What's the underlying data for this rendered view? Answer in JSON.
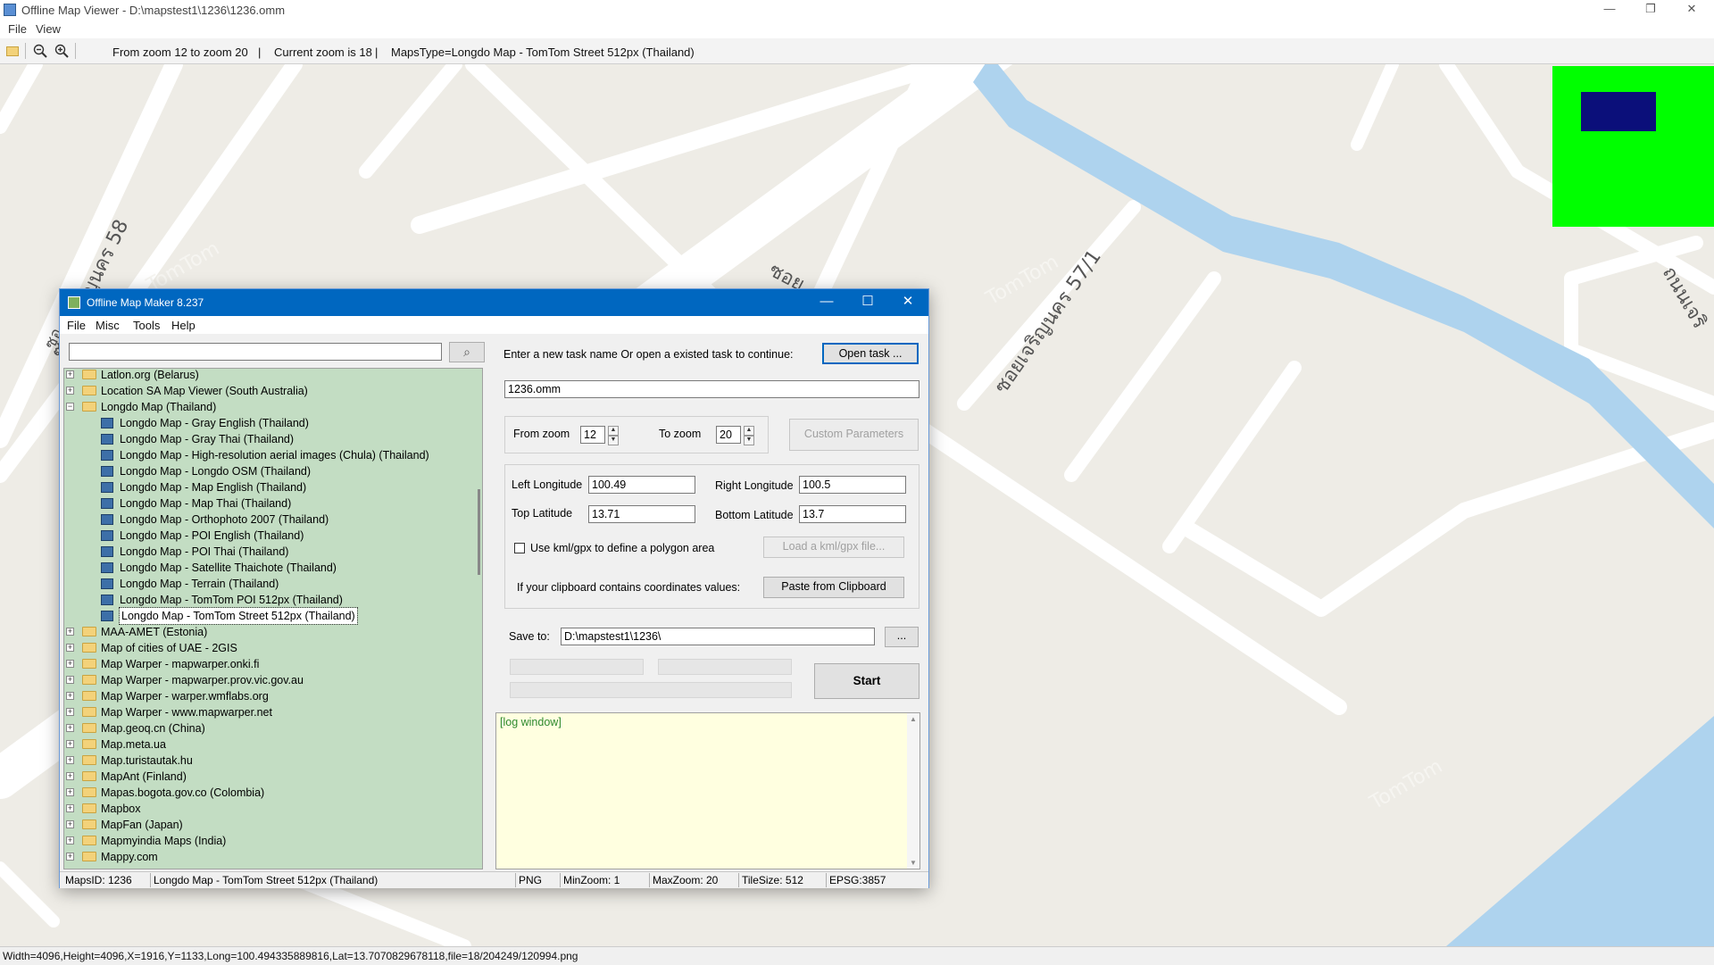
{
  "window": {
    "title": "Offline Map Viewer - D:\\mapstest1\\1236\\1236.omm",
    "controls": {
      "minimize": "—",
      "restore": "❐",
      "close": "✕"
    }
  },
  "menu": {
    "file": "File",
    "view": "View"
  },
  "toolbar": {
    "zoom_range": "From zoom 12 to zoom 20",
    "separator": "|",
    "current_zoom": "Current zoom is 18",
    "separator2": "|",
    "maps_type": "MapsType=Longdo Map - TomTom Street 512px (Thailand)"
  },
  "map": {
    "labels": [
      "ซอยเจริญนคร 58",
      "ซอยเจริญนคร 57/1",
      "ซอย",
      "ถนนเจริ",
      "ซอ",
      "ร"
    ],
    "watermark": "TomTom"
  },
  "statusbar": {
    "text": "Width=4096,Height=4096,X=1916,Y=1133,Long=100.494335889816,Lat=13.7070829678118,file=18/204249/120994.png"
  },
  "dialog": {
    "title": "Offline Map Maker 8.237",
    "controls": {
      "minimize": "—",
      "maximize": "☐",
      "close": "✕"
    },
    "menu": {
      "file": "File",
      "misc": "Misc",
      "tools": "Tools",
      "help": "Help"
    },
    "search": {
      "value": "",
      "button_icon": "⌕"
    },
    "tree": [
      {
        "label": "Latlon.org (Belarus)",
        "level": 0,
        "type": "folder",
        "expander": "+"
      },
      {
        "label": "Location SA Map Viewer (South Australia)",
        "level": 0,
        "type": "folder",
        "expander": "+"
      },
      {
        "label": "Longdo Map (Thailand)",
        "level": 0,
        "type": "folder-open",
        "expander": "−"
      },
      {
        "label": "Longdo Map - Gray English (Thailand)",
        "level": 1,
        "type": "map"
      },
      {
        "label": "Longdo Map - Gray Thai (Thailand)",
        "level": 1,
        "type": "map"
      },
      {
        "label": "Longdo Map - High-resolution aerial images (Chula) (Thailand)",
        "level": 1,
        "type": "map"
      },
      {
        "label": "Longdo Map - Longdo OSM (Thailand)",
        "level": 1,
        "type": "map"
      },
      {
        "label": "Longdo Map - Map English (Thailand)",
        "level": 1,
        "type": "map"
      },
      {
        "label": "Longdo Map - Map Thai (Thailand)",
        "level": 1,
        "type": "map"
      },
      {
        "label": "Longdo Map - Orthophoto 2007 (Thailand)",
        "level": 1,
        "type": "map"
      },
      {
        "label": "Longdo Map - POI English (Thailand)",
        "level": 1,
        "type": "map"
      },
      {
        "label": "Longdo Map - POI Thai (Thailand)",
        "level": 1,
        "type": "map"
      },
      {
        "label": "Longdo Map - Satellite Thaichote (Thailand)",
        "level": 1,
        "type": "map"
      },
      {
        "label": "Longdo Map - Terrain (Thailand)",
        "level": 1,
        "type": "map"
      },
      {
        "label": "Longdo Map - TomTom POI 512px (Thailand)",
        "level": 1,
        "type": "map"
      },
      {
        "label": "Longdo Map - TomTom Street 512px (Thailand)",
        "level": 1,
        "type": "map",
        "selected": true
      },
      {
        "label": "MAA-AMET (Estonia)",
        "level": 0,
        "type": "folder",
        "expander": "+"
      },
      {
        "label": "Map of cities of UAE - 2GIS",
        "level": 0,
        "type": "folder",
        "expander": "+"
      },
      {
        "label": "Map Warper - mapwarper.onki.fi",
        "level": 0,
        "type": "folder",
        "expander": "+"
      },
      {
        "label": "Map Warper - mapwarper.prov.vic.gov.au",
        "level": 0,
        "type": "folder",
        "expander": "+"
      },
      {
        "label": "Map Warper - warper.wmflabs.org",
        "level": 0,
        "type": "folder",
        "expander": "+"
      },
      {
        "label": "Map Warper - www.mapwarper.net",
        "level": 0,
        "type": "folder",
        "expander": "+"
      },
      {
        "label": "Map.geoq.cn (China)",
        "level": 0,
        "type": "folder",
        "expander": "+"
      },
      {
        "label": "Map.meta.ua",
        "level": 0,
        "type": "folder",
        "expander": "+"
      },
      {
        "label": "Map.turistautak.hu",
        "level": 0,
        "type": "folder",
        "expander": "+"
      },
      {
        "label": "MapAnt (Finland)",
        "level": 0,
        "type": "folder",
        "expander": "+"
      },
      {
        "label": "Mapas.bogota.gov.co (Colombia)",
        "level": 0,
        "type": "folder",
        "expander": "+"
      },
      {
        "label": "Mapbox",
        "level": 0,
        "type": "folder",
        "expander": "+"
      },
      {
        "label": "MapFan (Japan)",
        "level": 0,
        "type": "folder",
        "expander": "+"
      },
      {
        "label": "Mapmyindia Maps (India)",
        "level": 0,
        "type": "folder",
        "expander": "+"
      },
      {
        "label": "Mappy.com",
        "level": 0,
        "type": "folder",
        "expander": "+"
      }
    ],
    "task": {
      "prompt": "Enter a new task name Or open a existed task to continue:",
      "open_button": "Open task ...",
      "name_value": "1236.omm"
    },
    "zoom": {
      "from_label": "From zoom",
      "from_value": "12",
      "to_label": "To zoom",
      "to_value": "20",
      "custom_button": "Custom Parameters",
      "spin_up": "▲",
      "spin_down": "▼"
    },
    "bounds": {
      "left_label": "Left Longitude",
      "left_value": "100.49",
      "right_label": "Right Longitude",
      "right_value": "100.5",
      "top_label": "Top Latitude",
      "top_value": "13.71",
      "bottom_label": "Bottom Latitude",
      "bottom_value": "13.7"
    },
    "kml": {
      "checkbox_label": "Use kml/gpx to define a polygon area",
      "checked": false,
      "load_button": "Load a kml/gpx file..."
    },
    "clipboard": {
      "label": "If your clipboard contains coordinates values:",
      "button": "Paste from Clipboard"
    },
    "save": {
      "label": "Save to:",
      "value": "D:\\mapstest1\\1236\\",
      "browse": "..."
    },
    "start_button": "Start",
    "log": {
      "text": "[log window]",
      "scroll_up": "▲",
      "scroll_down": "▼"
    },
    "status": {
      "maps_id": "MapsID: 1236",
      "map_name": "Longdo Map - TomTom Street 512px (Thailand)",
      "format": "PNG",
      "min_zoom": "MinZoom: 1",
      "max_zoom": "MaxZoom: 20",
      "tile_size": "TileSize: 512",
      "epsg": "EPSG:3857"
    }
  },
  "colors": {
    "map_bg": "#eeece6",
    "road": "#ffffff",
    "water": "#aed3ee",
    "tree_bg": "#c3ddc3",
    "log_bg": "#ffffe0",
    "minimap": "#00ff00",
    "minimap_viewport": "#0b0f7a",
    "dialog_titlebar": "#0067c0"
  }
}
